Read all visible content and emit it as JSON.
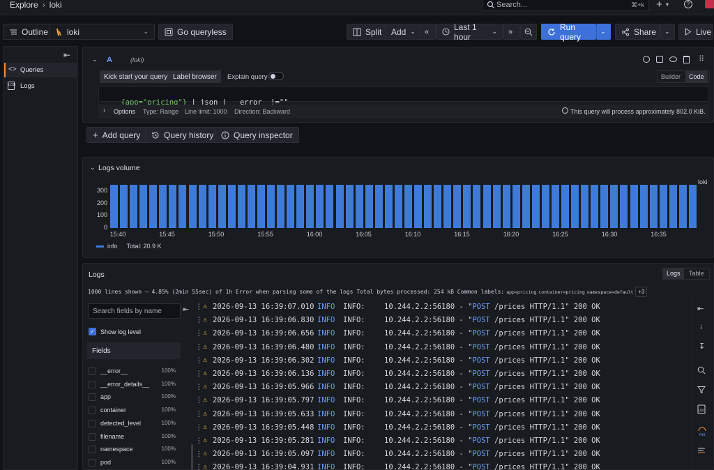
{
  "topbar": {
    "breadcrumb_root": "Explore",
    "breadcrumb_current": "loki",
    "search_placeholder": "Search...",
    "search_shortcut": "⌘+k",
    "add_label": "+",
    "help_label": "?"
  },
  "toolbar": {
    "outline_label": "Outline",
    "datasource_label": "loki",
    "go_queryless_label": "Go queryless",
    "split_label": "Split",
    "add_label": "Add",
    "time_range_label": "Last 1 hour",
    "run_query_label": "Run query",
    "share_label": "Share",
    "live_label": "Live",
    "accent_color": "#3d71d9"
  },
  "sidebar": {
    "items": [
      {
        "label": "Queries",
        "icon": "code-icon",
        "active": true
      },
      {
        "label": "Logs",
        "icon": "logs-icon",
        "active": false
      }
    ]
  },
  "query": {
    "ref_id": "A",
    "datasource": "(loki)",
    "kick_start_label": "Kick start your query",
    "label_browser_label": "Label browser",
    "explain_label": "Explain query",
    "builder_label": "Builder",
    "code_label": "Code",
    "expr_part1": "{app=\"pricing\"}",
    "expr_part2": " | json | __error__!=\"\"",
    "options_label": "Options",
    "option_type": "Type: Range",
    "option_limit": "Line limit: 1000",
    "option_direction": "Direction: Backward",
    "process_info": "This query will process approximately 802.0 KiB."
  },
  "query_actions": {
    "add_query_label": "Add query",
    "history_label": "Query history",
    "inspector_label": "Query inspector"
  },
  "logs_volume": {
    "title": "Logs volume",
    "series_label": "loki",
    "legend_name": "info",
    "legend_total": "Total: 20.9 K"
  },
  "chart_data": {
    "type": "bar",
    "title": "Logs volume",
    "ylim": [
      0,
      350
    ],
    "yticks": [
      "300",
      "200",
      "100",
      "0"
    ],
    "xticks": [
      "15:40",
      "15:45",
      "15:50",
      "15:55",
      "16:00",
      "16:05",
      "16:10",
      "16:15",
      "16:20",
      "16:25",
      "16:30",
      "16:35"
    ],
    "series": [
      {
        "name": "info",
        "color": "#3e7bd9",
        "values": [
          350,
          350,
          350,
          350,
          350,
          350,
          350,
          350,
          350,
          350,
          350,
          350,
          350,
          350,
          350,
          350,
          350,
          350,
          350,
          350,
          350,
          350,
          350,
          350,
          350,
          350,
          350,
          350,
          350,
          350,
          350,
          350,
          350,
          350,
          350,
          350,
          350,
          350,
          350,
          350,
          350,
          350,
          350,
          350,
          350,
          350,
          350,
          350,
          350,
          350,
          350,
          350,
          350,
          350,
          350,
          350,
          350,
          350,
          350,
          350
        ]
      }
    ]
  },
  "logs": {
    "title": "Logs",
    "tab_logs": "Logs",
    "tab_table": "Table",
    "meta_text": "1000 lines shown — 4.85% (2min 55sec) of 1h  Error when parsing some of the logs  Total bytes processed: 254 kB  Common labels:",
    "common_labels": [
      "app=pricing",
      "container=pricing",
      "namespace=default"
    ],
    "more_labels": "+3",
    "search_placeholder": "Search fields by name",
    "show_log_level_label": "Show log level",
    "fields_title": "Fields",
    "fields": [
      {
        "name": "__error__",
        "pct": "100%"
      },
      {
        "name": "__error_details__",
        "pct": "100%"
      },
      {
        "name": "app",
        "pct": "100%"
      },
      {
        "name": "container",
        "pct": "100%"
      },
      {
        "name": "detected_level",
        "pct": "100%"
      },
      {
        "name": "filename",
        "pct": "100%"
      },
      {
        "name": "namespace",
        "pct": "100%"
      },
      {
        "name": "pod",
        "pct": "100%"
      }
    ],
    "rows": [
      {
        "ts": "2026-09-13 16:39:07.010",
        "level": "INFO",
        "msg_a": "INFO:",
        "msg_b": "10.244.2.2:56180 - \"",
        "method": "POST",
        "msg_c": " /prices HTTP/1.1\" 200 OK"
      },
      {
        "ts": "2026-09-13 16:39:06.830",
        "level": "INFO",
        "msg_a": "INFO:",
        "msg_b": "10.244.2.2:56180 - \"",
        "method": "POST",
        "msg_c": " /prices HTTP/1.1\" 200 OK"
      },
      {
        "ts": "2026-09-13 16:39:06.656",
        "level": "INFO",
        "msg_a": "INFO:",
        "msg_b": "10.244.2.2:56180 - \"",
        "method": "POST",
        "msg_c": " /prices HTTP/1.1\" 200 OK"
      },
      {
        "ts": "2026-09-13 16:39:06.480",
        "level": "INFO",
        "msg_a": "INFO:",
        "msg_b": "10.244.2.2:56180 - \"",
        "method": "POST",
        "msg_c": " /prices HTTP/1.1\" 200 OK"
      },
      {
        "ts": "2026-09-13 16:39:06.302",
        "level": "INFO",
        "msg_a": "INFO:",
        "msg_b": "10.244.2.2:56180 - \"",
        "method": "POST",
        "msg_c": " /prices HTTP/1.1\" 200 OK"
      },
      {
        "ts": "2026-09-13 16:39:06.136",
        "level": "INFO",
        "msg_a": "INFO:",
        "msg_b": "10.244.2.2:56180 - \"",
        "method": "POST",
        "msg_c": " /prices HTTP/1.1\" 200 OK"
      },
      {
        "ts": "2026-09-13 16:39:05.966",
        "level": "INFO",
        "msg_a": "INFO:",
        "msg_b": "10.244.2.2:56180 - \"",
        "method": "POST",
        "msg_c": " /prices HTTP/1.1\" 200 OK"
      },
      {
        "ts": "2026-09-13 16:39:05.797",
        "level": "INFO",
        "msg_a": "INFO:",
        "msg_b": "10.244.2.2:56180 - \"",
        "method": "POST",
        "msg_c": " /prices HTTP/1.1\" 200 OK"
      },
      {
        "ts": "2026-09-13 16:39:05.633",
        "level": "INFO",
        "msg_a": "INFO:",
        "msg_b": "10.244.2.2:56180 - \"",
        "method": "POST",
        "msg_c": " /prices HTTP/1.1\" 200 OK"
      },
      {
        "ts": "2026-09-13 16:39:05.448",
        "level": "INFO",
        "msg_a": "INFO:",
        "msg_b": "10.244.2.2:56180 - \"",
        "method": "POST",
        "msg_c": " /prices HTTP/1.1\" 200 OK"
      },
      {
        "ts": "2026-09-13 16:39:05.281",
        "level": "INFO",
        "msg_a": "INFO:",
        "msg_b": "10.244.2.2:56180 - \"",
        "method": "POST",
        "msg_c": " /prices HTTP/1.1\" 200 OK"
      },
      {
        "ts": "2026-09-13 16:39:05.097",
        "level": "INFO",
        "msg_a": "INFO:",
        "msg_b": "10.244.2.2:56180 - \"",
        "method": "POST",
        "msg_c": " /prices HTTP/1.1\" 200 OK"
      },
      {
        "ts": "2026-09-13 16:39:04.931",
        "level": "INFO",
        "msg_a": "INFO:",
        "msg_b": "10.244.2.2:56180 - \"",
        "method": "POST",
        "msg_c": " /prices HTTP/1.1\" 200 OK"
      }
    ]
  }
}
